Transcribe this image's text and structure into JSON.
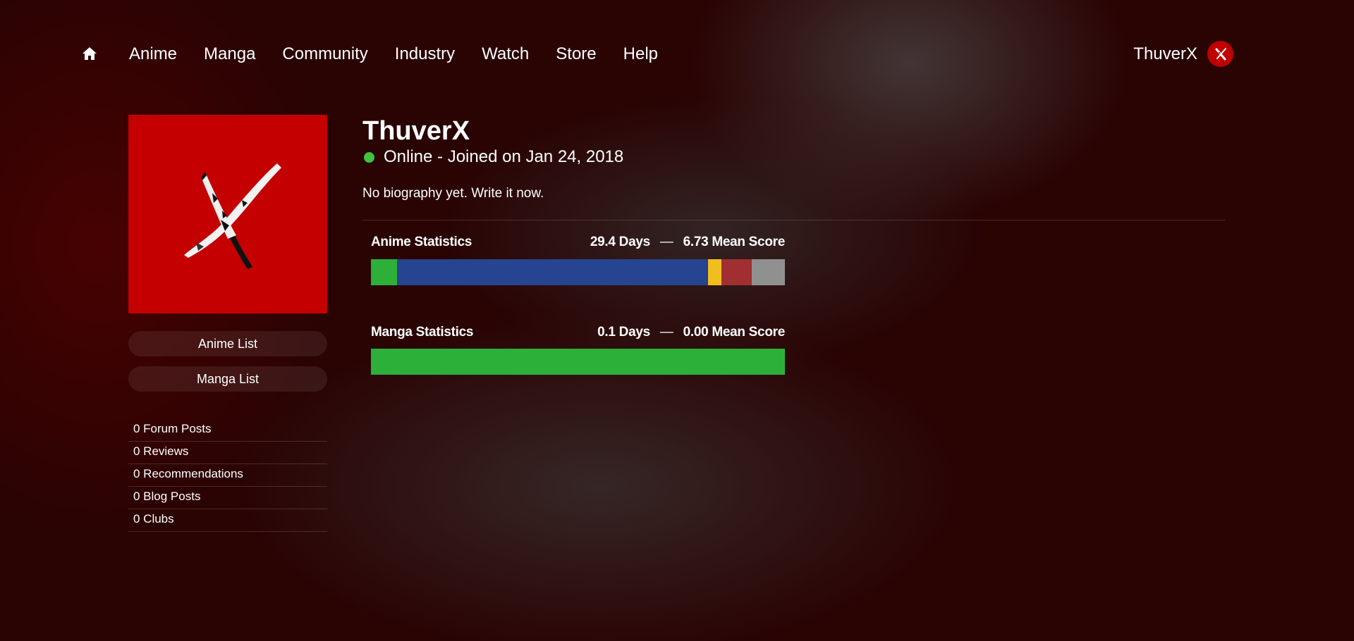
{
  "nav": {
    "home_icon": "home-icon",
    "links": [
      "Anime",
      "Manga",
      "Community",
      "Industry",
      "Watch",
      "Store",
      "Help"
    ],
    "username": "ThuverX"
  },
  "sidebar": {
    "anime_list_label": "Anime List",
    "manga_list_label": "Manga List",
    "stats": [
      "0 Forum Posts",
      "0 Reviews",
      "0 Recommendations",
      "0 Blog Posts",
      "0 Clubs"
    ]
  },
  "profile": {
    "name": "ThuverX",
    "status": "Online - Joined on Jan 24, 2018",
    "bio": "No biography yet. Write it now."
  },
  "anime_stats": {
    "title": "Anime Statistics",
    "days": "29.4 Days",
    "separator": "—",
    "mean_score": "6.73 Mean Score",
    "segments": [
      {
        "color": "#2db039",
        "fraction": 0.063
      },
      {
        "color": "#26448f",
        "fraction": 0.752
      },
      {
        "color": "#f1be1e",
        "fraction": 0.032
      },
      {
        "color": "#a12f31",
        "fraction": 0.073
      },
      {
        "color": "#909090",
        "fraction": 0.08
      }
    ]
  },
  "manga_stats": {
    "title": "Manga Statistics",
    "days": "0.1 Days",
    "separator": "—",
    "mean_score": "0.00 Mean Score",
    "segments": [
      {
        "color": "#2db039",
        "fraction": 1.0
      }
    ]
  },
  "colors": {
    "online": "#3ec43e",
    "avatar_bg": "#c40000"
  }
}
